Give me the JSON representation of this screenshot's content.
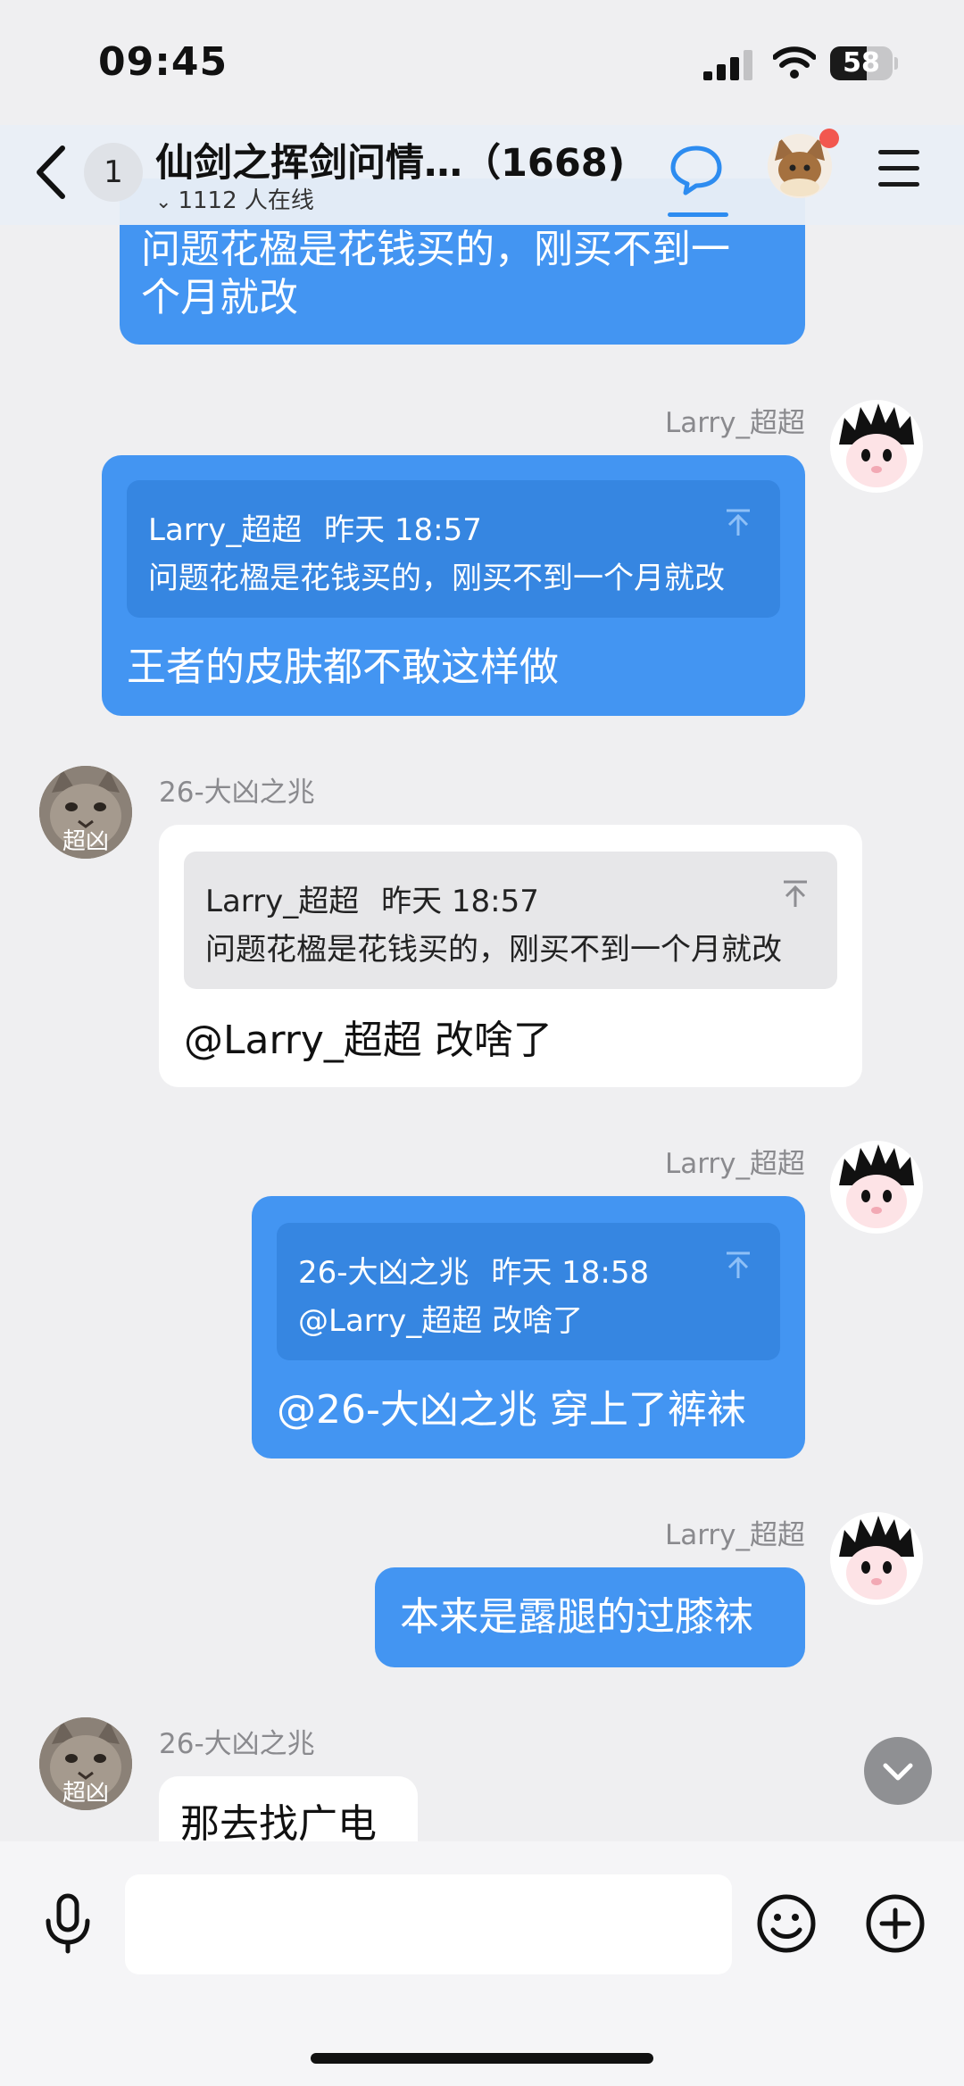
{
  "status_bar": {
    "time": "09:45",
    "battery": "58",
    "battery_level": 0.58
  },
  "header": {
    "unread_count": "1",
    "title": "仙剑之挥剑问情…（1668)",
    "online": "1112 人在线",
    "icons": [
      "chevron-left-icon",
      "chat-bubble-icon",
      "menu-icon",
      "mic-icon",
      "smiley-icon",
      "plus-circle-icon"
    ],
    "accent_color": "#2d8cf0",
    "badge_color": "#f2574f"
  },
  "messages": [
    {
      "sender": "",
      "side": "right",
      "lines": [
        "问题花楹是花钱买的，刚买不到一",
        "个月就改"
      ]
    },
    {
      "sender": "Larry_超超",
      "side": "right",
      "quote": {
        "author": "Larry_超超",
        "time": "昨天 18:57",
        "text": "问题花楹是花钱买的，刚买不到一个月就改"
      },
      "text": "王者的皮肤都不敢这样做"
    },
    {
      "sender": "26-大凶之兆",
      "side": "left",
      "avatar_label": "超凶",
      "quote": {
        "author": "Larry_超超",
        "time": "昨天 18:57",
        "text": "问题花楹是花钱买的，刚买不到一个月就改"
      },
      "text": "@Larry_超超 改啥了"
    },
    {
      "sender": "Larry_超超",
      "side": "right",
      "quote": {
        "author": "26-大凶之兆",
        "time": "昨天 18:58",
        "text": "@Larry_超超 改啥了"
      },
      "text": "@26-大凶之兆 穿上了裤袜"
    },
    {
      "sender": "Larry_超超",
      "side": "right",
      "text": "本来是露腿的过膝袜"
    },
    {
      "sender": "26-大凶之兆",
      "side": "left",
      "avatar_label": "超凶",
      "text": "那去找广电"
    }
  ],
  "input": {
    "value": "",
    "placeholder": ""
  },
  "colors": {
    "my_bubble": "#4395f2",
    "my_quote": "#3686e1",
    "background": "#efeff1"
  }
}
